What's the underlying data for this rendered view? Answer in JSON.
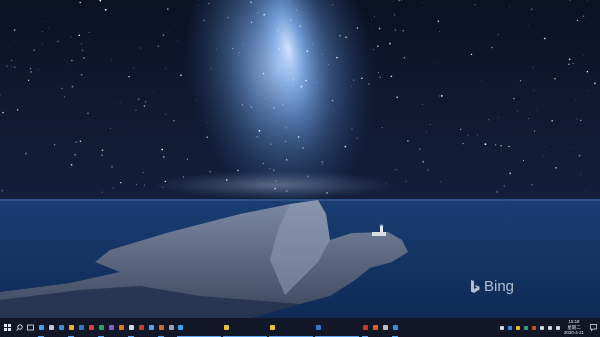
{
  "desktop": {
    "wallpaper": "Milky Way over lighthouse headland at night",
    "watermark": {
      "brand": "Bing",
      "icon": "bing-logo-icon"
    }
  },
  "taskbar": {
    "start": {
      "icon": "windows-start-icon"
    },
    "search": {
      "icon": "search-icon"
    },
    "task_view": {
      "icon": "task-view-icon"
    },
    "apps": [
      {
        "name": "app-1",
        "color": "#4ea0e6"
      },
      {
        "name": "app-2",
        "color": "#c0c7d2"
      },
      {
        "name": "app-3",
        "color": "#3c8ed8"
      },
      {
        "name": "app-4",
        "color": "#e8b23a"
      },
      {
        "name": "app-5",
        "color": "#3a78d0"
      },
      {
        "name": "app-6",
        "color": "#d04a3a"
      },
      {
        "name": "app-7",
        "color": "#2e9e6a"
      },
      {
        "name": "app-8",
        "color": "#8a5ad6"
      },
      {
        "name": "app-9",
        "color": "#e07a2a"
      },
      {
        "name": "app-10",
        "color": "#d3d9e2"
      },
      {
        "name": "app-11",
        "color": "#c93a3a"
      },
      {
        "name": "app-12",
        "color": "#5aa4e8"
      },
      {
        "name": "app-13",
        "color": "#d06a2e"
      },
      {
        "name": "app-14",
        "color": "#9aa3b0"
      }
    ],
    "windows": [
      {
        "label": "",
        "icon_color": "#3aa4ea"
      },
      {
        "label": "",
        "icon_color": "#e8c23a"
      },
      {
        "label": "",
        "icon_color": "#e8c23a"
      },
      {
        "label": "",
        "icon_color": "#3a78d0"
      }
    ],
    "apps_after": [
      {
        "name": "app-15",
        "color": "#c8372e"
      },
      {
        "name": "app-16",
        "color": "#e05a2a"
      },
      {
        "name": "app-17",
        "color": "#b7c0cc"
      },
      {
        "name": "app-18",
        "color": "#3c8ed8"
      }
    ],
    "tray": [
      {
        "name": "chevron-up-icon",
        "color": "#cfd6e0"
      },
      {
        "name": "tray-app-1",
        "color": "#3c8ed8"
      },
      {
        "name": "tray-app-2",
        "color": "#e8b23a"
      },
      {
        "name": "tray-app-3",
        "color": "#2e9e6a"
      },
      {
        "name": "tray-app-4",
        "color": "#d04a3a"
      },
      {
        "name": "network-icon",
        "color": "#cfd6e0"
      },
      {
        "name": "volume-icon",
        "color": "#cfd6e0"
      },
      {
        "name": "ime-icon",
        "color": "#cfd6e0"
      }
    ],
    "clock": {
      "time": "15:18",
      "weekday": "星期二",
      "date": "2020-4-21"
    },
    "notifications": {
      "icon": "notification-icon"
    }
  }
}
